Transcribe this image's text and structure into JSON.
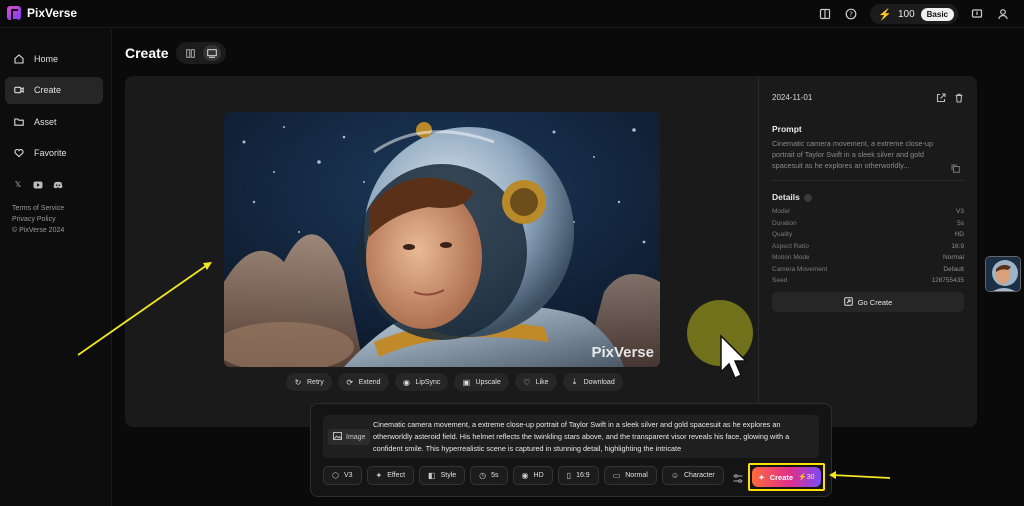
{
  "app": {
    "name": "PixVerse"
  },
  "topbar": {
    "credits": "100",
    "plan": "Basic"
  },
  "sidebar": {
    "items": [
      {
        "label": "Home",
        "icon": "home-icon",
        "active": false
      },
      {
        "label": "Create",
        "icon": "video-icon",
        "active": true
      },
      {
        "label": "Asset",
        "icon": "folder-icon",
        "active": false
      },
      {
        "label": "Favorite",
        "icon": "heart-icon",
        "active": false
      }
    ],
    "legal": {
      "terms": "Terms of Service",
      "privacy": "Privacy Policy",
      "copyright": "© PixVerse 2024"
    }
  },
  "main": {
    "title": "Create",
    "watermark": "PixVerse",
    "actions": [
      {
        "label": "Retry",
        "icon": "retry-icon"
      },
      {
        "label": "Extend",
        "icon": "extend-icon"
      },
      {
        "label": "LipSync",
        "icon": "lipsync-icon"
      },
      {
        "label": "Upscale",
        "icon": "upscale-icon"
      },
      {
        "label": "Like",
        "icon": "heart-icon"
      },
      {
        "label": "Download",
        "icon": "download-icon"
      }
    ]
  },
  "details_panel": {
    "date": "2024-11-01",
    "prompt_title": "Prompt",
    "prompt_text": "Cinematic camera movement, a extreme close-up portrait of Taylor Swift in a sleek silver and gold spacesuit as he explores an otherworldly...",
    "details_title": "Details",
    "rows": [
      {
        "label": "Model",
        "value": "V3"
      },
      {
        "label": "Duration",
        "value": "5s"
      },
      {
        "label": "Quality",
        "value": "HD"
      },
      {
        "label": "Aspect Ratio",
        "value": "16:9"
      },
      {
        "label": "Motion Mode",
        "value": "Normal"
      },
      {
        "label": "Camera Movement",
        "value": "Default"
      },
      {
        "label": "Seed",
        "value": "128755435"
      }
    ],
    "go_create": "Go Create"
  },
  "composer": {
    "image_chip": "Image",
    "prompt": "Cinematic camera movement, a extreme close-up portrait of Taylor Swift in a sleek silver and gold spacesuit as he explores an otherworldly asteroid field. His helmet reflects the twinkling stars above, and the transparent visor reveals his face, glowing with a confident smile. This hyperrealistic scene is captured in stunning detail, highlighting the intricate",
    "options": [
      {
        "label": "V3",
        "icon": "cube-icon"
      },
      {
        "label": "Effect",
        "icon": "sparkle-icon"
      },
      {
        "label": "Style",
        "icon": "style-icon"
      },
      {
        "label": "5s",
        "icon": "clock-icon"
      },
      {
        "label": "HD",
        "icon": "eye-icon"
      },
      {
        "label": "16:9",
        "icon": "aspect-icon"
      },
      {
        "label": "Normal",
        "icon": "camera-icon"
      },
      {
        "label": "Character",
        "icon": "face-icon"
      }
    ],
    "create_label": "Create",
    "create_cost": "30"
  },
  "colors": {
    "accent_yellow": "#ffe000",
    "credit_bolt": "#f4c21b",
    "create_gradient_start": "#ff6a3d",
    "create_gradient_end": "#7b4cf5"
  }
}
